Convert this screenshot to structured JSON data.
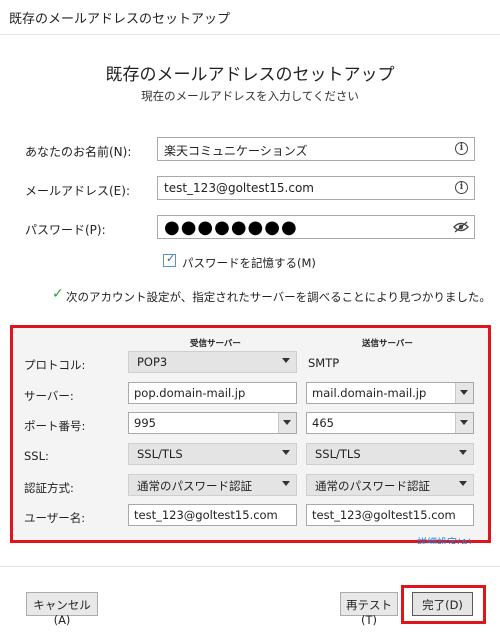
{
  "window": {
    "title": "既存のメールアドレスのセットアップ"
  },
  "header": {
    "title": "既存のメールアドレスのセットアップ",
    "subtitle": "現在のメールアドレスを入力してください"
  },
  "form": {
    "name_label": "あなたのお名前(N):",
    "name_value": "楽天コミュニケーションズ",
    "email_label": "メールアドレス(E):",
    "email_value": "test_123@goltest15.com",
    "password_label": "パスワード(P):",
    "password_value": "●●●●●●●●",
    "remember_label": "パスワードを記憶する(M)",
    "remember_checked": true
  },
  "status": {
    "found_text": "次のアカウント設定が、指定されたサーバーを調べることにより見つかりました。"
  },
  "server": {
    "incoming_header": "受信サーバー",
    "outgoing_header": "送信サーバー",
    "protocol_label": "プロトコル:",
    "protocol_in": "POP3",
    "protocol_out": "SMTP",
    "server_label": "サーバー:",
    "server_in": "pop.domain-mail.jp",
    "server_out": "mail.domain-mail.jp",
    "port_label": "ポート番号:",
    "port_in": "995",
    "port_out": "465",
    "ssl_label": "SSL:",
    "ssl_in": "SSL/TLS",
    "ssl_out": "SSL/TLS",
    "auth_label": "認証方式:",
    "auth_in": "通常のパスワード認証",
    "auth_out": "通常のパスワード認証",
    "user_label": "ユーザー名:",
    "user_in": "test_123@goltest15.com",
    "user_out": "test_123@goltest15.com",
    "advanced_link": "詳細設定(A)"
  },
  "buttons": {
    "cancel": "キャンセル(A)",
    "retest": "再テスト(T)",
    "done": "完了(D)"
  },
  "colors": {
    "highlight": "#e0141c",
    "check_green": "#2e9e3a",
    "link_blue": "#2b78d0"
  }
}
